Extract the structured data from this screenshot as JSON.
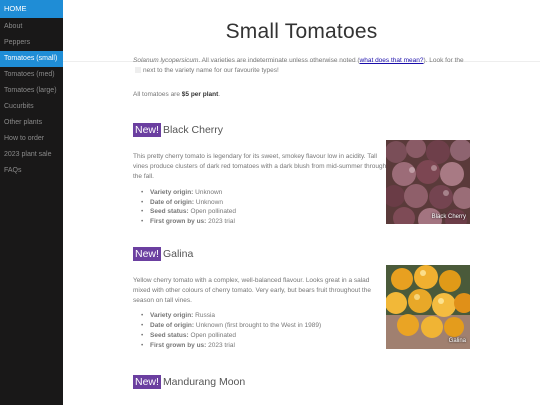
{
  "nav": {
    "home": "HOME",
    "items": [
      {
        "label": "About"
      },
      {
        "label": "Peppers"
      },
      {
        "label": "Tomatoes (small)"
      },
      {
        "label": "Tomatoes (med)"
      },
      {
        "label": "Tomatoes (large)"
      },
      {
        "label": "Cucurbits"
      },
      {
        "label": "Other plants"
      },
      {
        "label": "How to order"
      },
      {
        "label": "2023 plant sale"
      },
      {
        "label": "FAQs"
      }
    ],
    "active_index": 2,
    "active_color": "#1f8dd6",
    "background": "#191818"
  },
  "page": {
    "title": "Small Tomatoes"
  },
  "intro": {
    "species": "Solanum lycopersicum",
    "text_after_species": ". All varieties are indeterminate unless otherwise noted (",
    "link_text": "what does that mean?",
    "text_after_link": "). Look for the",
    "text_end": "next to the variety name for our favourite types!",
    "price_prefix": "All tomatoes are ",
    "price": "$5 per plant",
    "price_suffix": "."
  },
  "badge_label": "New!",
  "badge_color": "#6b3fa0",
  "fact_labels": {
    "origin": "Variety origin:",
    "date": "Date of origin:",
    "seed": "Seed status:",
    "grown": "First grown by us:"
  },
  "varieties": [
    {
      "name": "Black Cherry",
      "description": "This pretty cherry tomato is legendary for its sweet, smokey flavour low in acidity. Tall vines produce clusters of dark red tomatoes with a dark blush from mid-summer through the fall.",
      "origin": "Unknown",
      "date": "Unknown",
      "seed": "Open pollinated",
      "grown": "2023 trial",
      "photo_caption": "Black Cherry",
      "photo_icon": "dark-cherry-tomatoes-photo"
    },
    {
      "name": "Galina",
      "description": "Yellow cherry tomato with a complex, well-balanced flavour. Looks great in a salad mixed with other colours of cherry tomato. Very early, but bears fruit throughout the season on tall vines.",
      "origin": "Russia",
      "date": "Unknown (first brought to the West in 1989)",
      "seed": "Open pollinated",
      "grown": "2023 trial",
      "photo_caption": "Galina",
      "photo_icon": "yellow-cherry-tomatoes-photo"
    },
    {
      "name": "Mandurang Moon"
    }
  ]
}
